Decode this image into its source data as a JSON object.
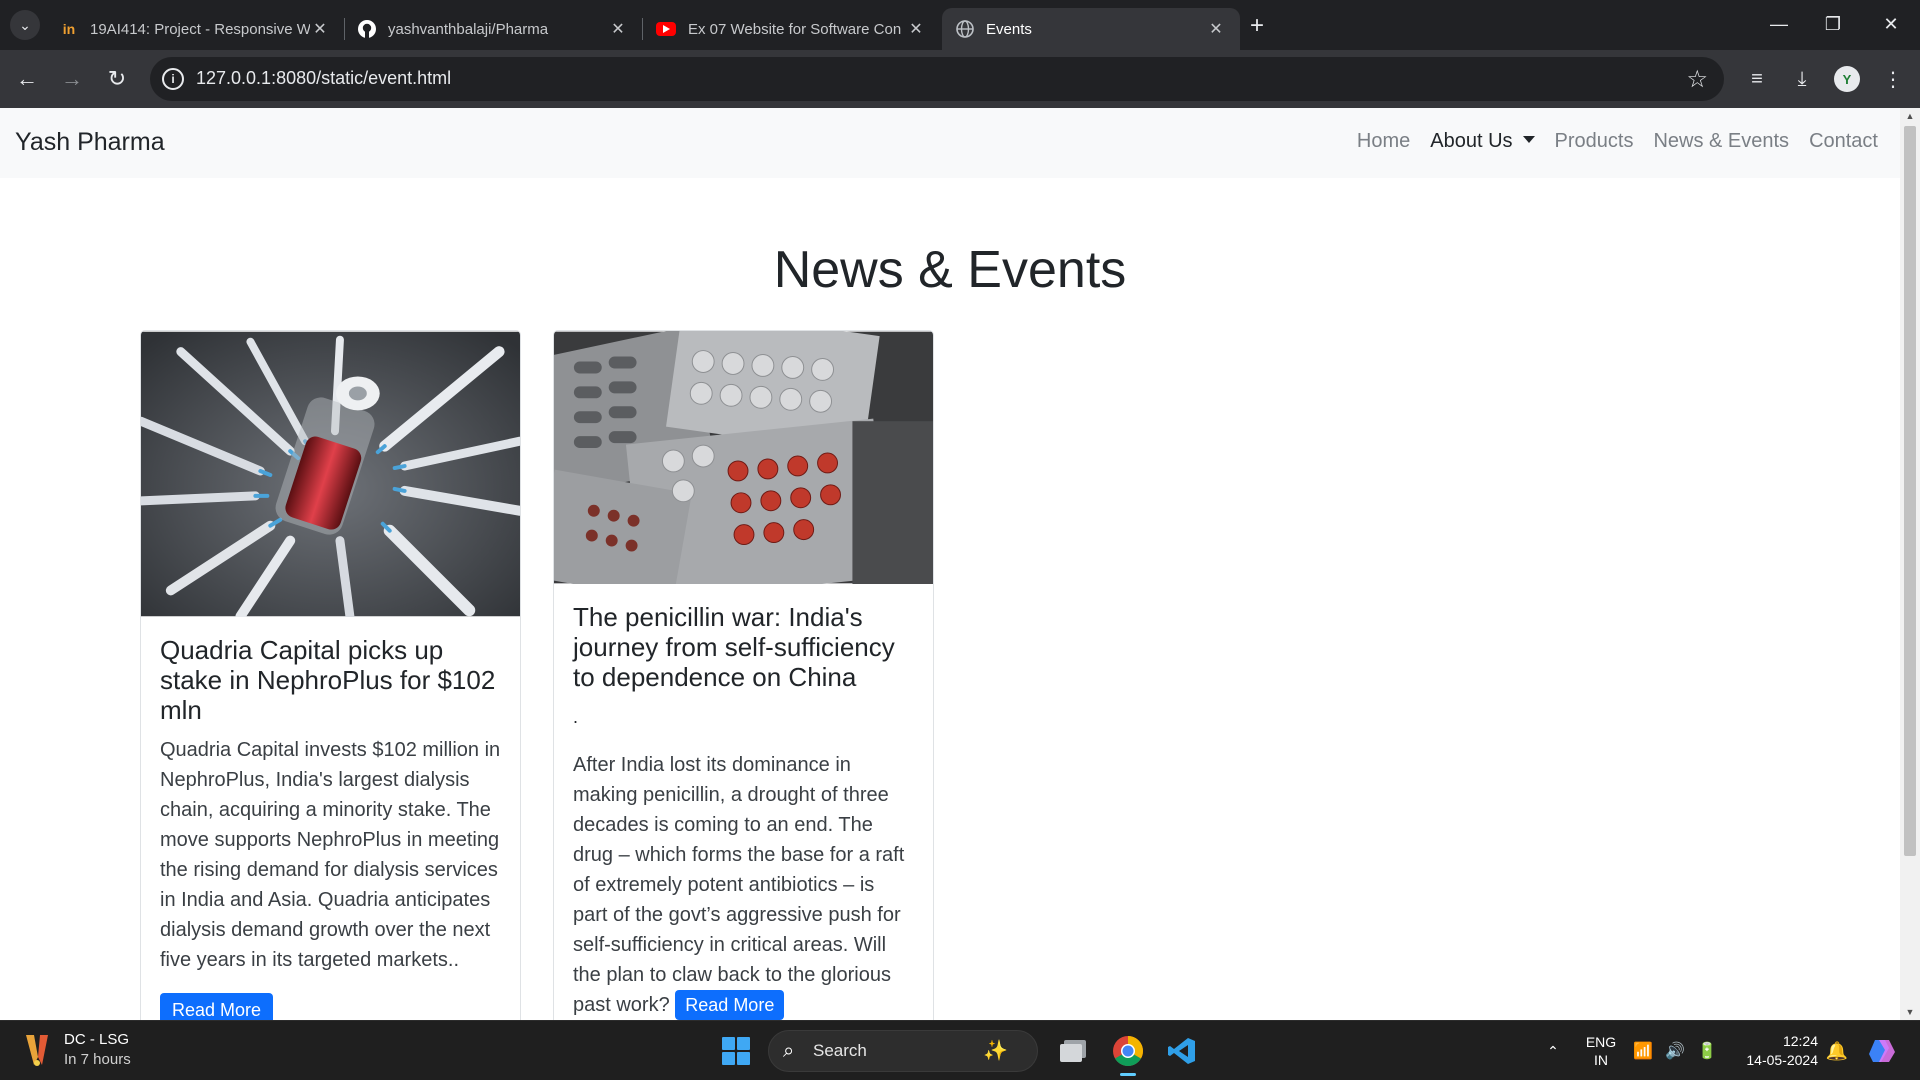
{
  "browser": {
    "tabs": [
      {
        "title": "19AI414: Project - Responsive W",
        "favicon": "lines-logo-icon",
        "active": false
      },
      {
        "title": "yashvanthbalaji/Pharma",
        "favicon": "github-icon",
        "active": false
      },
      {
        "title": "Ex 07 Website for Software Con",
        "favicon": "youtube-icon",
        "active": false
      },
      {
        "title": "Events",
        "favicon": "globe-icon",
        "active": true
      }
    ],
    "url": "127.0.0.1:8080/static/event.html",
    "accent": "#35363a"
  },
  "site": {
    "brand": "Yash Pharma",
    "nav": [
      {
        "label": "Home",
        "active": false
      },
      {
        "label": "About Us",
        "active": true,
        "dropdown": true
      },
      {
        "label": "Products",
        "active": false
      },
      {
        "label": "News & Events",
        "active": false
      },
      {
        "label": "Contact",
        "active": false
      }
    ],
    "page_title": "News & Events",
    "cards": [
      {
        "image": "syringes-vial-photo",
        "title": "Quadria Capital picks up stake in NephroPlus for $102 mln",
        "text": "Quadria Capital invests $102 million in NephroPlus, India's largest dialysis chain, acquiring a minority stake. The move supports NephroPlus in meeting the rising demand for dialysis services in India and Asia. Quadria anticipates dialysis demand growth over the next five years in its targeted markets..",
        "button": "Read More"
      },
      {
        "image": "pill-blister-packs-photo",
        "title": "The penicillin war: India's journey from self-sufficiency to dependence on China",
        "dot": ".",
        "text": "After India lost its dominance in making penicillin, a drought of three decades is coming to an end. The drug – which forms the base for a raft of extremely potent antibiotics – is part of the govt’s aggressive push for self-sufficiency in critical areas. Will the plan to claw back to the glorious past work?",
        "button": "Read More"
      }
    ],
    "button_color": "#0d6efd"
  },
  "taskbar": {
    "weather_title": "DC - LSG",
    "weather_sub": "In 7 hours",
    "search_label": "Search",
    "lang_line1": "ENG",
    "lang_line2": "IN",
    "time": "12:24",
    "date": "14-05-2024"
  }
}
